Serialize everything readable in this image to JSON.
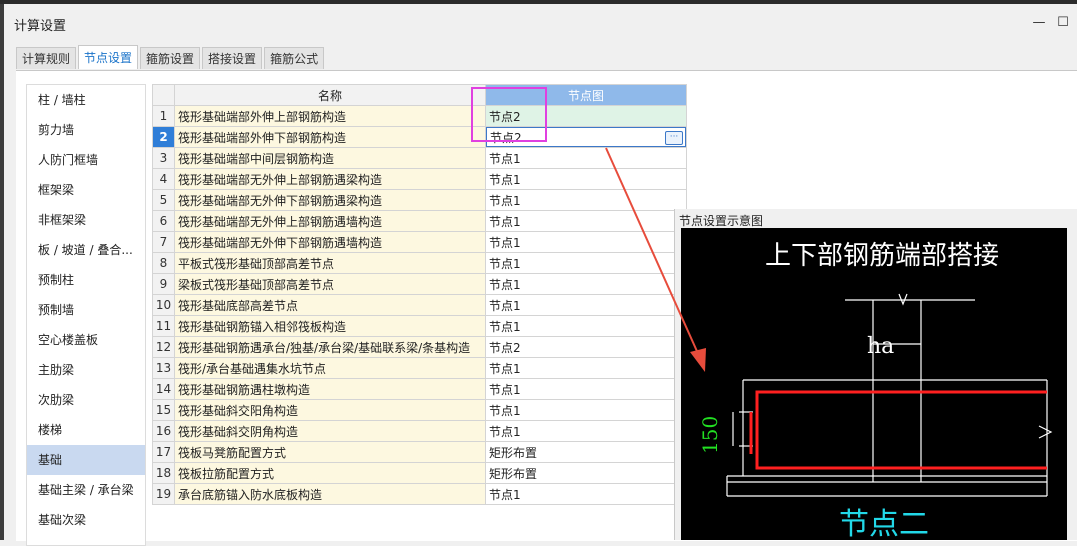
{
  "window": {
    "title": "计算设置",
    "minimize_glyph": "—",
    "maximize_glyph": "☐"
  },
  "tabs": [
    {
      "label": "计算规则",
      "active": false
    },
    {
      "label": "节点设置",
      "active": true
    },
    {
      "label": "箍筋设置",
      "active": false
    },
    {
      "label": "搭接设置",
      "active": false
    },
    {
      "label": "箍筋公式",
      "active": false
    }
  ],
  "sidebar": {
    "items": [
      {
        "label": "柱 / 墙柱"
      },
      {
        "label": "剪力墙"
      },
      {
        "label": "人防门框墙"
      },
      {
        "label": "框架梁"
      },
      {
        "label": "非框架梁"
      },
      {
        "label": "板 / 坡道 / 叠合..."
      },
      {
        "label": "预制柱"
      },
      {
        "label": "预制墙"
      },
      {
        "label": "空心楼盖板"
      },
      {
        "label": "主肋梁"
      },
      {
        "label": "次肋梁"
      },
      {
        "label": "楼梯"
      },
      {
        "label": "基础",
        "active": true
      },
      {
        "label": "基础主梁 / 承台梁"
      },
      {
        "label": "基础次梁"
      }
    ]
  },
  "table": {
    "headers": {
      "name": "名称",
      "node": "节点图"
    },
    "rows": [
      {
        "no": "1",
        "name": "筏形基础端部外伸上部钢筋构造",
        "value": "节点2"
      },
      {
        "no": "2",
        "name": "筏形基础端部外伸下部钢筋构造",
        "value": "节点2"
      },
      {
        "no": "3",
        "name": "筏形基础端部中间层钢筋构造",
        "value": "节点1"
      },
      {
        "no": "4",
        "name": "筏形基础端部无外伸上部钢筋遇梁构造",
        "value": "节点1"
      },
      {
        "no": "5",
        "name": "筏形基础端部无外伸下部钢筋遇梁构造",
        "value": "节点1"
      },
      {
        "no": "6",
        "name": "筏形基础端部无外伸上部钢筋遇墙构造",
        "value": "节点1"
      },
      {
        "no": "7",
        "name": "筏形基础端部无外伸下部钢筋遇墙构造",
        "value": "节点1"
      },
      {
        "no": "8",
        "name": "平板式筏形基础顶部高差节点",
        "value": "节点1"
      },
      {
        "no": "9",
        "name": "梁板式筏形基础顶部高差节点",
        "value": "节点1"
      },
      {
        "no": "10",
        "name": "筏形基础底部高差节点",
        "value": "节点1"
      },
      {
        "no": "11",
        "name": "筏形基础钢筋锚入相邻筏板构造",
        "value": "节点1"
      },
      {
        "no": "12",
        "name": "筏形基础钢筋遇承台/独基/承台梁/基础联系梁/条基构造",
        "value": "节点2"
      },
      {
        "no": "13",
        "name": "筏形/承台基础遇集水坑节点",
        "value": "节点1"
      },
      {
        "no": "14",
        "name": "筏形基础钢筋遇柱墩构造",
        "value": "节点1"
      },
      {
        "no": "15",
        "name": "筏形基础斜交阳角构造",
        "value": "节点1"
      },
      {
        "no": "16",
        "name": "筏形基础斜交阴角构造",
        "value": "节点1"
      },
      {
        "no": "17",
        "name": "筏板马凳筋配置方式",
        "value": "矩形布置"
      },
      {
        "no": "18",
        "name": "筏板拉筋配置方式",
        "value": "矩形布置"
      },
      {
        "no": "19",
        "name": "承台底筋锚入防水底板构造",
        "value": "节点1"
      }
    ],
    "selected_row": 2,
    "edit_button": "···"
  },
  "preview": {
    "title": "节点设置示意图",
    "diagram_title": "上下部钢筋端部搭接",
    "label_ha": "ha",
    "label_dim": "150",
    "node_label": "节点二",
    "colors": {
      "rebar": "#ff2020",
      "dimension": "#22e022",
      "node_label": "#22d8e8",
      "annotation_arrow": "#e74c3c",
      "highlight": "#e040e0"
    }
  }
}
